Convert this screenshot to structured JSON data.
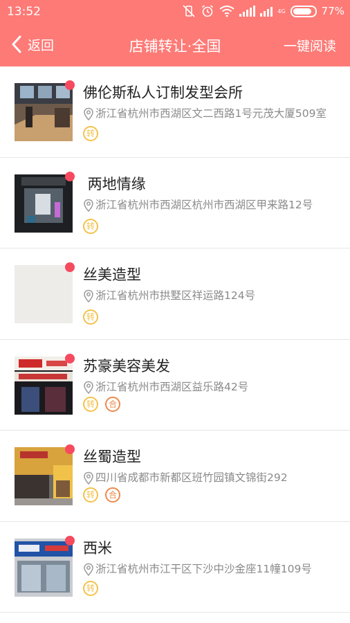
{
  "status_bar": {
    "time": "13:52",
    "battery": "77%",
    "network": "4G"
  },
  "nav": {
    "back_label": "返回",
    "title": "店铺转让·全国",
    "read_all_label": "一键阅读"
  },
  "tags": {
    "transfer": "转",
    "partner": "合"
  },
  "items": [
    {
      "name": "佛伦斯私人订制发型会所",
      "address": "浙江省杭州市西湖区文二西路1号元茂大厦509室",
      "tags": [
        "转"
      ]
    },
    {
      "name": " 两地情缘",
      "address": "浙江省杭州市西湖区杭州市西湖区甲来路12号",
      "tags": [
        "转"
      ]
    },
    {
      "name": "丝美造型",
      "address": "浙江省杭州市拱墅区祥运路124号",
      "tags": [
        "转"
      ]
    },
    {
      "name": "苏豪美容美发",
      "address": "浙江省杭州市西湖区益乐路42号",
      "tags": [
        "转",
        "合"
      ]
    },
    {
      "name": "丝蜀造型",
      "address": "四川省成都市新都区班竹园镇文锦街292",
      "tags": [
        "转",
        "合"
      ]
    },
    {
      "name": "西米",
      "address": "浙江省杭州市江干区下沙中沙金座11幢109号",
      "tags": [
        "转"
      ]
    }
  ],
  "colors": {
    "header": "#fd7a76",
    "unread_dot": "#f64a5f",
    "transfer_tag": "#f3c24c",
    "partner_tag": "#ec8a4c"
  }
}
